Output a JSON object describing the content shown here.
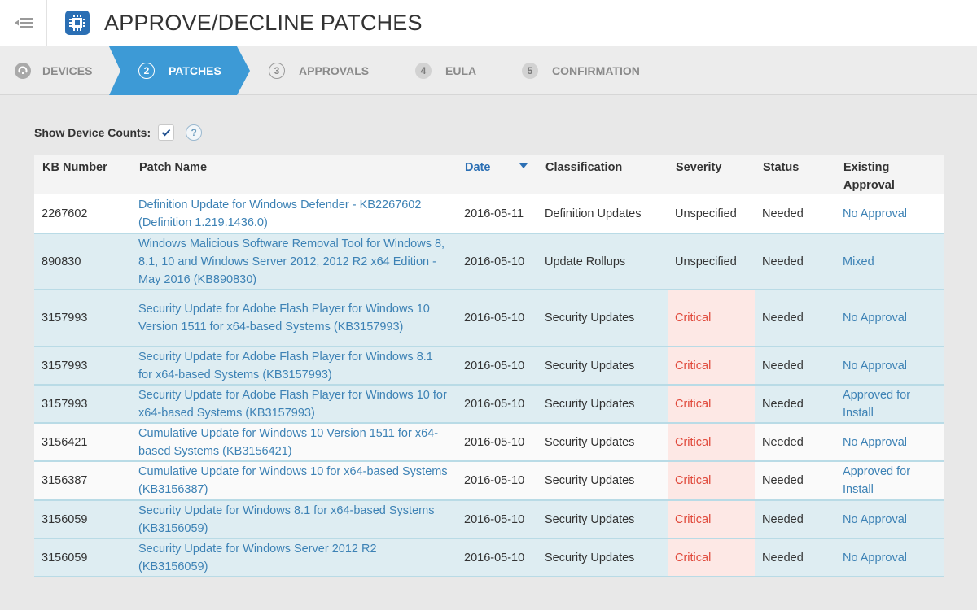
{
  "header": {
    "title": "APPROVE/DECLINE PATCHES"
  },
  "wizard": {
    "steps": [
      {
        "num": "",
        "label": "DEVICES"
      },
      {
        "num": "2",
        "label": "PATCHES"
      },
      {
        "num": "3",
        "label": "APPROVALS"
      },
      {
        "num": "4",
        "label": "EULA"
      },
      {
        "num": "5",
        "label": "CONFIRMATION"
      }
    ]
  },
  "options": {
    "show_counts_label": "Show Device Counts:",
    "help": "?"
  },
  "table": {
    "headers": {
      "kb": "KB Number",
      "name": "Patch Name",
      "date": "Date",
      "classification": "Classification",
      "severity": "Severity",
      "status": "Status",
      "approval": "Existing Approval"
    },
    "rows": [
      {
        "kb": "2267602",
        "name": "Definition Update for Windows Defender - KB2267602 (Definition 1.219.1436.0)",
        "date": "2016-05-11",
        "classification": "Definition Updates",
        "severity": "Unspecified",
        "status": "Needed",
        "approval": "No Approval"
      },
      {
        "kb": "890830",
        "name": "Windows Malicious Software Removal Tool for Windows 8, 8.1, 10 and Windows Server 2012, 2012 R2 x64 Edition - May 2016 (KB890830)",
        "date": "2016-05-10",
        "classification": "Update Rollups",
        "severity": "Unspecified",
        "status": "Needed",
        "approval": "Mixed"
      },
      {
        "kb": "3157993",
        "name": "Security Update for Adobe Flash Player for Windows 10 Version 1511 for x64-based Systems (KB3157993)",
        "date": "2016-05-10",
        "classification": "Security Updates",
        "severity": "Critical",
        "status": "Needed",
        "approval": "No Approval"
      },
      {
        "kb": "3157993",
        "name": "Security Update for Adobe Flash Player for Windows 8.1 for x64-based Systems (KB3157993)",
        "date": "2016-05-10",
        "classification": "Security Updates",
        "severity": "Critical",
        "status": "Needed",
        "approval": "No Approval"
      },
      {
        "kb": "3157993",
        "name": "Security Update for Adobe Flash Player for Windows 10 for x64-based Systems (KB3157993)",
        "date": "2016-05-10",
        "classification": "Security Updates",
        "severity": "Critical",
        "status": "Needed",
        "approval": "Approved for Install"
      },
      {
        "kb": "3156421",
        "name": "Cumulative Update for Windows 10 Version 1511 for x64-based Systems (KB3156421)",
        "date": "2016-05-10",
        "classification": "Security Updates",
        "severity": "Critical",
        "status": "Needed",
        "approval": "No Approval"
      },
      {
        "kb": "3156387",
        "name": "Cumulative Update for Windows 10 for x64-based Systems (KB3156387)",
        "date": "2016-05-10",
        "classification": "Security Updates",
        "severity": "Critical",
        "status": "Needed",
        "approval": "Approved for Install"
      },
      {
        "kb": "3156059",
        "name": "Security Update for Windows 8.1 for x64-based Systems (KB3156059)",
        "date": "2016-05-10",
        "classification": "Security Updates",
        "severity": "Critical",
        "status": "Needed",
        "approval": "No Approval"
      },
      {
        "kb": "3156059",
        "name": "Security Update for Windows Server 2012 R2 (KB3156059)",
        "date": "2016-05-10",
        "classification": "Security Updates",
        "severity": "Critical",
        "status": "Needed",
        "approval": "No Approval"
      }
    ]
  },
  "colors": {
    "accent": "#3d9ad6",
    "link": "#3d82b5",
    "critical": "#e0483a",
    "critical_bg": "#fde8e5",
    "row_blue": "#deedf2"
  }
}
